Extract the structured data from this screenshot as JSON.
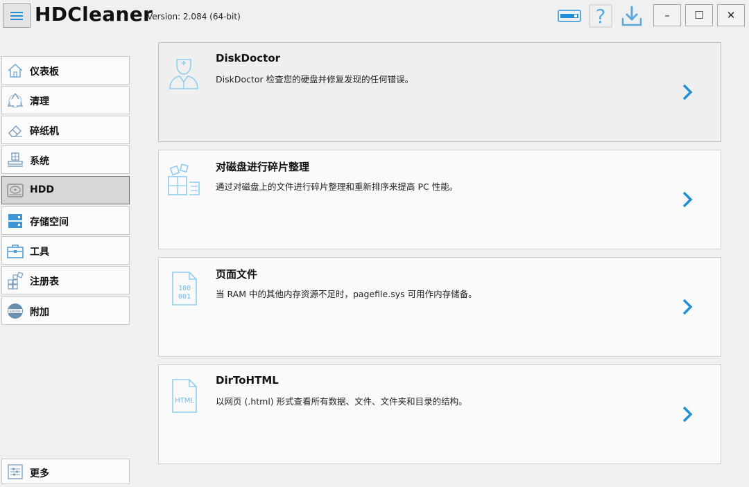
{
  "app": {
    "title": "HDCleaner",
    "version": "Version: 2.084 (64-bit)"
  },
  "window_controls": {
    "minimize": "–",
    "maximize": "☐",
    "close": "✕"
  },
  "toolbar": {
    "icons": [
      "license-icon",
      "help-icon",
      "download-icon"
    ]
  },
  "sidebar": {
    "items": [
      {
        "label": "仪表板",
        "icon": "home-icon",
        "active": false
      },
      {
        "label": "清理",
        "icon": "recycle-icon",
        "active": false
      },
      {
        "label": "碎纸机",
        "icon": "eraser-icon",
        "active": false
      },
      {
        "label": "系统",
        "icon": "system-icon",
        "active": false
      },
      {
        "label": "HDD",
        "icon": "hdd-icon",
        "active": true
      },
      {
        "label": "存储空间",
        "icon": "storage-icon",
        "active": false
      },
      {
        "label": "工具",
        "icon": "toolbox-icon",
        "active": false
      },
      {
        "label": "注册表",
        "icon": "registry-icon",
        "active": false
      },
      {
        "label": "附加",
        "icon": "extra-icon",
        "active": false
      }
    ],
    "more_label": "更多"
  },
  "cards": [
    {
      "title": "DiskDoctor",
      "desc": "DiskDoctor 检查您的硬盘并修复发现的任何错误。",
      "icon": "doctor-icon"
    },
    {
      "title": "对磁盘进行碎片整理",
      "desc": "通过对磁盘上的文件进行碎片整理和重新排序来提高 PC 性能。",
      "icon": "defrag-icon"
    },
    {
      "title": "页面文件",
      "desc": "当 RAM 中的其他内存资源不足时，pagefile.sys 可用作内存储备。",
      "icon": "binary-file-icon"
    },
    {
      "title": "DirToHTML",
      "desc": "以网页 (.html) 形式查看所有数据、文件、文件夹和目录的结构。",
      "icon": "html-file-icon"
    }
  ],
  "colors": {
    "accent": "#1e90d8",
    "icon_light": "#8ecdf0",
    "arrow": "#1e90d8"
  }
}
